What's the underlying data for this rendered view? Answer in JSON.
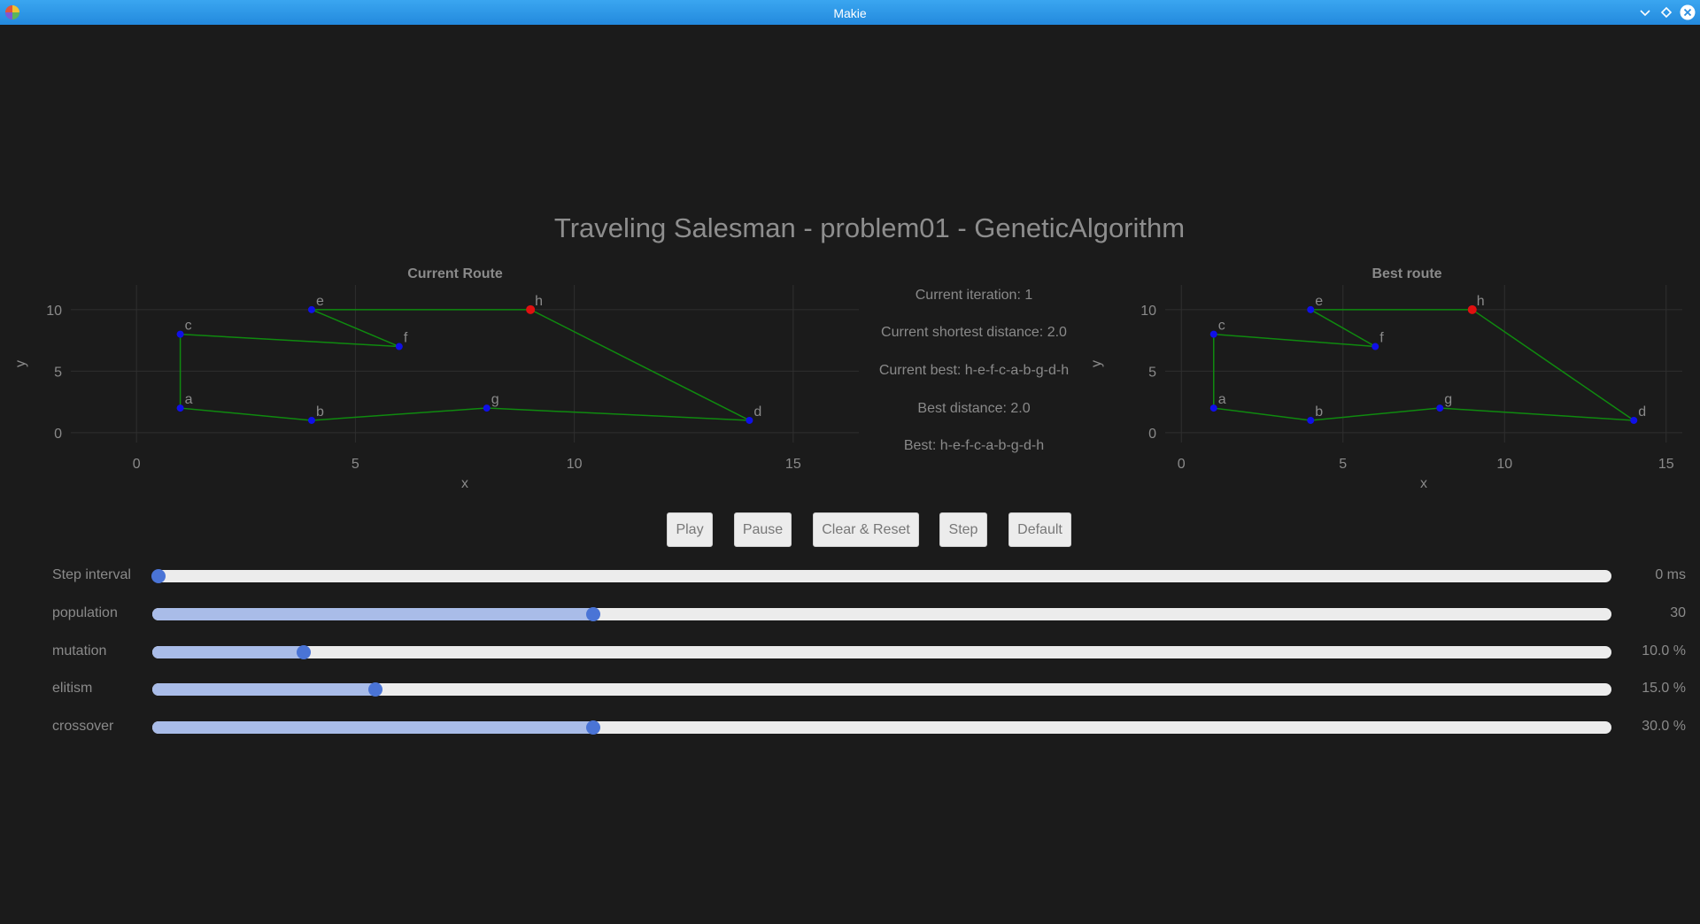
{
  "window": {
    "title": "Makie"
  },
  "main_title": "Traveling Salesman - problem01 - GeneticAlgorithm",
  "plots": {
    "current": {
      "title": "Current Route",
      "xlabel": "x",
      "ylabel": "y"
    },
    "best": {
      "title": "Best route",
      "xlabel": "x",
      "ylabel": "y"
    }
  },
  "chart_data": [
    {
      "type": "scatter",
      "title": "Current Route",
      "xlabel": "x",
      "ylabel": "y",
      "xlim": [
        -1.5,
        16.5
      ],
      "ylim": [
        -0.8,
        12
      ],
      "xticks": [
        0,
        5,
        10,
        15
      ],
      "yticks": [
        0,
        5,
        10
      ],
      "grid": true,
      "points": [
        {
          "name": "a",
          "x": 1,
          "y": 2
        },
        {
          "name": "b",
          "x": 4,
          "y": 1
        },
        {
          "name": "c",
          "x": 1,
          "y": 8
        },
        {
          "name": "d",
          "x": 14,
          "y": 1
        },
        {
          "name": "e",
          "x": 4,
          "y": 10
        },
        {
          "name": "f",
          "x": 6,
          "y": 7
        },
        {
          "name": "g",
          "x": 8,
          "y": 2
        },
        {
          "name": "h",
          "x": 9,
          "y": 10
        }
      ],
      "route": [
        "h",
        "e",
        "f",
        "c",
        "a",
        "b",
        "g",
        "d",
        "h"
      ],
      "start": "h",
      "point_color": "#1010e8",
      "start_color": "#e01010",
      "route_color": "#0f8a0f"
    },
    {
      "type": "scatter",
      "title": "Best route",
      "xlabel": "x",
      "ylabel": "y",
      "xlim": [
        -0.5,
        15.5
      ],
      "ylim": [
        -0.8,
        12
      ],
      "xticks": [
        0,
        5,
        10,
        15
      ],
      "yticks": [
        0,
        5,
        10
      ],
      "grid": true,
      "points": [
        {
          "name": "a",
          "x": 1,
          "y": 2
        },
        {
          "name": "b",
          "x": 4,
          "y": 1
        },
        {
          "name": "c",
          "x": 1,
          "y": 8
        },
        {
          "name": "d",
          "x": 14,
          "y": 1
        },
        {
          "name": "e",
          "x": 4,
          "y": 10
        },
        {
          "name": "f",
          "x": 6,
          "y": 7
        },
        {
          "name": "g",
          "x": 8,
          "y": 2
        },
        {
          "name": "h",
          "x": 9,
          "y": 10
        }
      ],
      "route": [
        "h",
        "e",
        "f",
        "c",
        "a",
        "b",
        "g",
        "d",
        "h"
      ],
      "start": "h",
      "point_color": "#1010e8",
      "start_color": "#e01010",
      "route_color": "#0f8a0f"
    }
  ],
  "info": {
    "iteration": "Current iteration: 1",
    "shortest": "Current shortest distance: 2.0",
    "current_best": "Current best: h-e-f-c-a-b-g-d-h",
    "best_distance": "Best distance: 2.0",
    "best": "Best: h-e-f-c-a-b-g-d-h"
  },
  "buttons": {
    "play": "Play",
    "pause": "Pause",
    "clear_reset": "Clear & Reset",
    "step": "Step",
    "default": "Default"
  },
  "sliders": [
    {
      "label": "Step interval",
      "value": "0 ms",
      "fraction": 0.004
    },
    {
      "label": "population",
      "value": "30",
      "fraction": 0.302
    },
    {
      "label": "mutation",
      "value": "10.0 %",
      "fraction": 0.104
    },
    {
      "label": "elitism",
      "value": "15.0 %",
      "fraction": 0.153
    },
    {
      "label": "crossover",
      "value": "30.0 %",
      "fraction": 0.302
    }
  ],
  "colors": {
    "titlebar": "#2a93e4",
    "slider_fill": "#a9bce8",
    "slider_knob": "#4a74d6"
  }
}
